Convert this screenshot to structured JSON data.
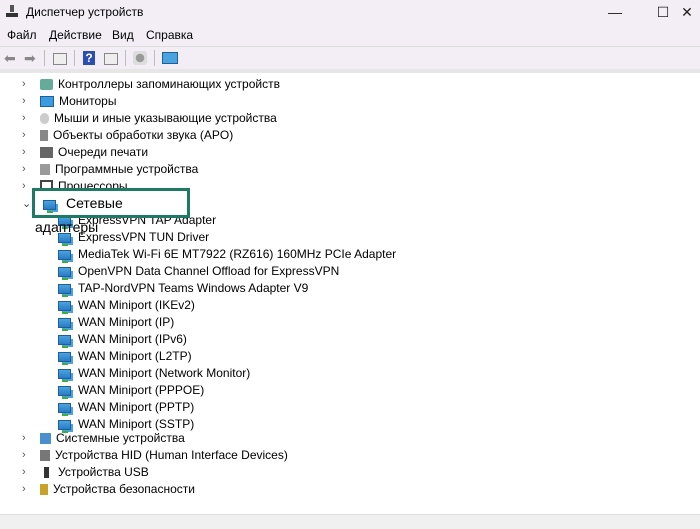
{
  "window": {
    "title": "Диспетчер устройств",
    "minimize": "—",
    "maximize": "☐",
    "close": "✕"
  },
  "menu": [
    "Файл",
    "Действие",
    "Вид",
    "Справка"
  ],
  "toolbar": [
    "back-icon",
    "forward-icon",
    "properties-icon",
    "help-icon",
    "view-icon",
    "scan-hardware-icon",
    "monitor-icon"
  ],
  "tree": {
    "before": [
      {
        "label": "Контроллеры запоминающих устройств",
        "icon": "storage-controller-icon"
      },
      {
        "label": "Мониторы",
        "icon": "monitor-icon"
      },
      {
        "label": "Мыши и иные указывающие устройства",
        "icon": "mouse-icon"
      },
      {
        "label": "Объекты обработки звука (APO)",
        "icon": "audio-icon"
      },
      {
        "label": "Очереди печати",
        "icon": "printer-icon"
      },
      {
        "label": "Программные устройства",
        "icon": "software-device-icon"
      },
      {
        "label": "Процессоры",
        "icon": "processor-icon"
      }
    ],
    "expanded": {
      "label": "Сетевые адаптеры",
      "icon": "network-adapter-icon",
      "highlight": "#1e7a64",
      "children": [
        "ExpressVPN TAP Adapter",
        "ExpressVPN TUN Driver",
        "MediaTek Wi-Fi 6E MT7922 (RZ616) 160MHz PCIe Adapter",
        "OpenVPN Data Channel Offload for ExpressVPN",
        "TAP-NordVPN Teams Windows Adapter V9",
        "WAN Miniport (IKEv2)",
        "WAN Miniport (IP)",
        "WAN Miniport (IPv6)",
        "WAN Miniport (L2TP)",
        "WAN Miniport (Network Monitor)",
        "WAN Miniport (PPPOE)",
        "WAN Miniport (PPTP)",
        "WAN Miniport (SSTP)"
      ]
    },
    "after": [
      {
        "label": "Системные устройства",
        "icon": "system-device-icon"
      },
      {
        "label": "Устройства HID (Human Interface Devices)",
        "icon": "hid-icon"
      },
      {
        "label": "Устройства USB",
        "icon": "usb-icon"
      },
      {
        "label": "Устройства безопасности",
        "icon": "security-icon"
      }
    ]
  }
}
